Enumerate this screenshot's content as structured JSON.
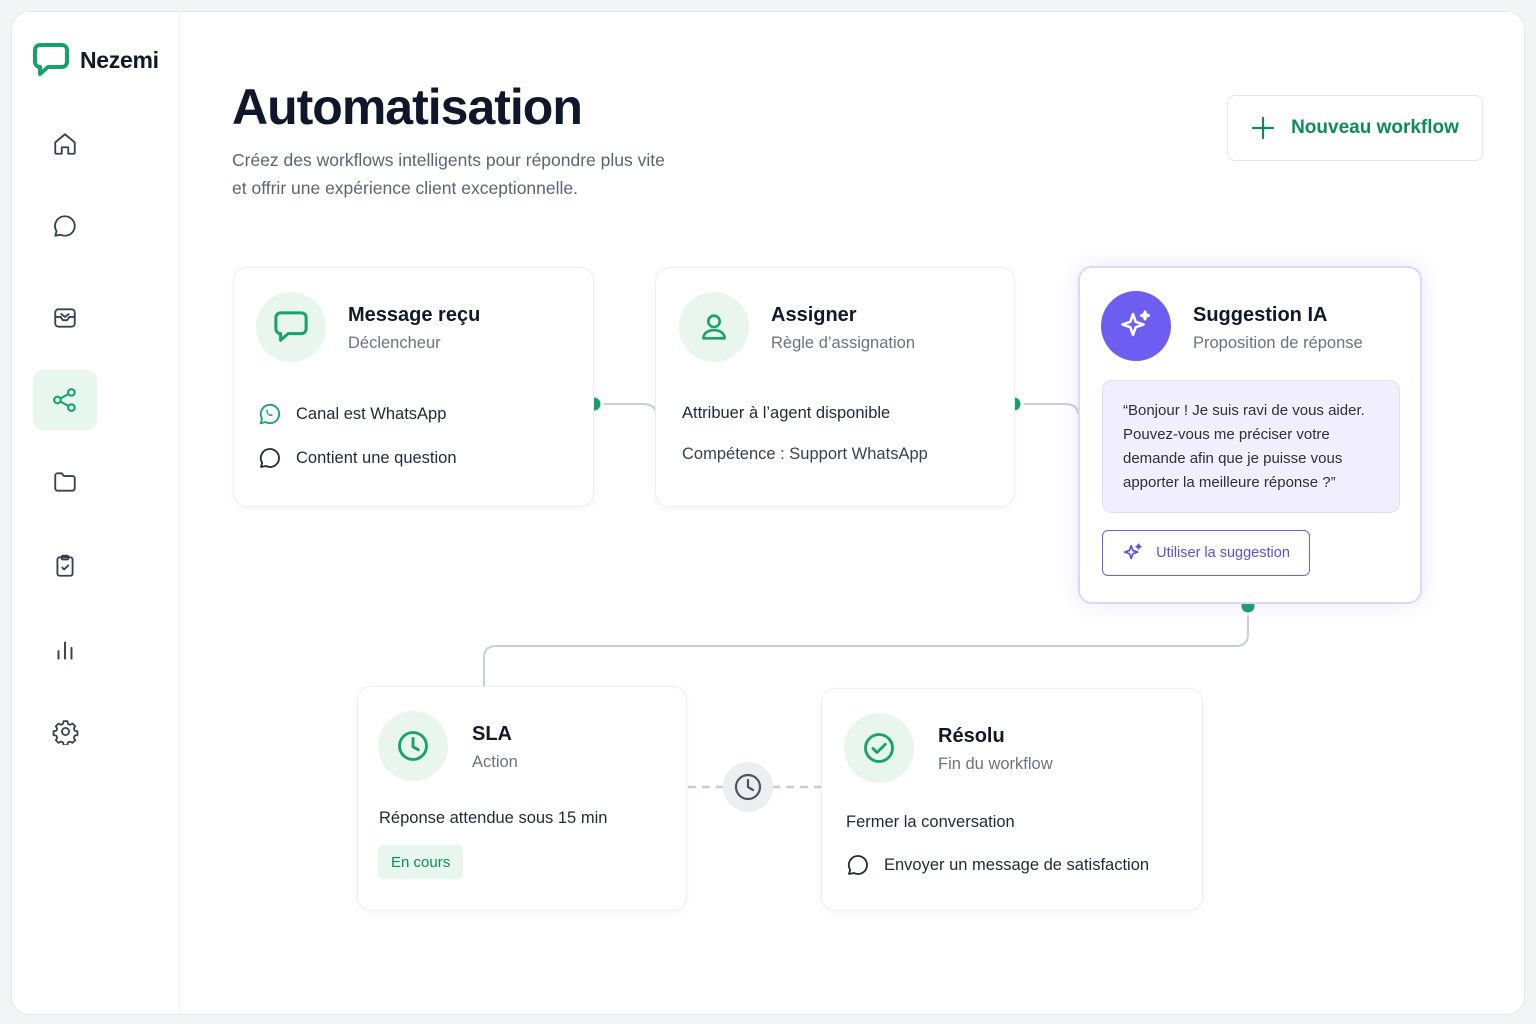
{
  "brand": {
    "name": "Nezemi",
    "color": "#16a36a"
  },
  "sidebar": {
    "items": [
      {
        "icon": "home-icon",
        "active": false
      },
      {
        "icon": "chat-icon",
        "active": false
      },
      {
        "icon": "inbox-icon",
        "active": false
      },
      {
        "icon": "workflow-share-icon",
        "active": true
      },
      {
        "icon": "folder-icon",
        "active": false
      },
      {
        "icon": "clipboard-check-icon",
        "active": false
      },
      {
        "icon": "bar-chart-icon",
        "active": false
      },
      {
        "icon": "gear-icon",
        "active": false
      }
    ]
  },
  "header": {
    "title": "Automatisation",
    "subtitle_line1": "Créez des workflows intelligents pour répondre plus vite",
    "subtitle_line2": "et offrir une expérience client exceptionnelle.",
    "new_workflow_label": "Nouveau workflow"
  },
  "workflow": {
    "trigger": {
      "title": "Message reçu",
      "subtitle": "Déclencheur",
      "conditions": [
        "Canal est WhatsApp",
        "Contient une question"
      ]
    },
    "assign": {
      "title": "Assigner",
      "subtitle": "Règle d’assignation",
      "line1": "Attribuer à l’agent disponible",
      "line2": "Compétence : Support WhatsApp"
    },
    "ai": {
      "title": "Suggestion IA",
      "subtitle": "Proposition de réponse",
      "quote": "“Bonjour ! Je suis ravi de vous aider. Pouvez-vous me préciser votre demande afin que je puisse vous apporter la meilleure réponse ?”",
      "use_label": "Utiliser la suggestion"
    },
    "sla": {
      "title": "SLA",
      "subtitle": "Action",
      "line1": "Réponse attendue sous 15 min",
      "badge": "En cours"
    },
    "resolved": {
      "title": "Résolu",
      "subtitle": "Fin du workflow",
      "line1": "Fermer la conversation",
      "line2": "Envoyer un message de satisfaction"
    }
  },
  "colors": {
    "accent_green": "#16a36a",
    "accent_purple": "#6d5df0",
    "connector": "#c9ced6"
  }
}
